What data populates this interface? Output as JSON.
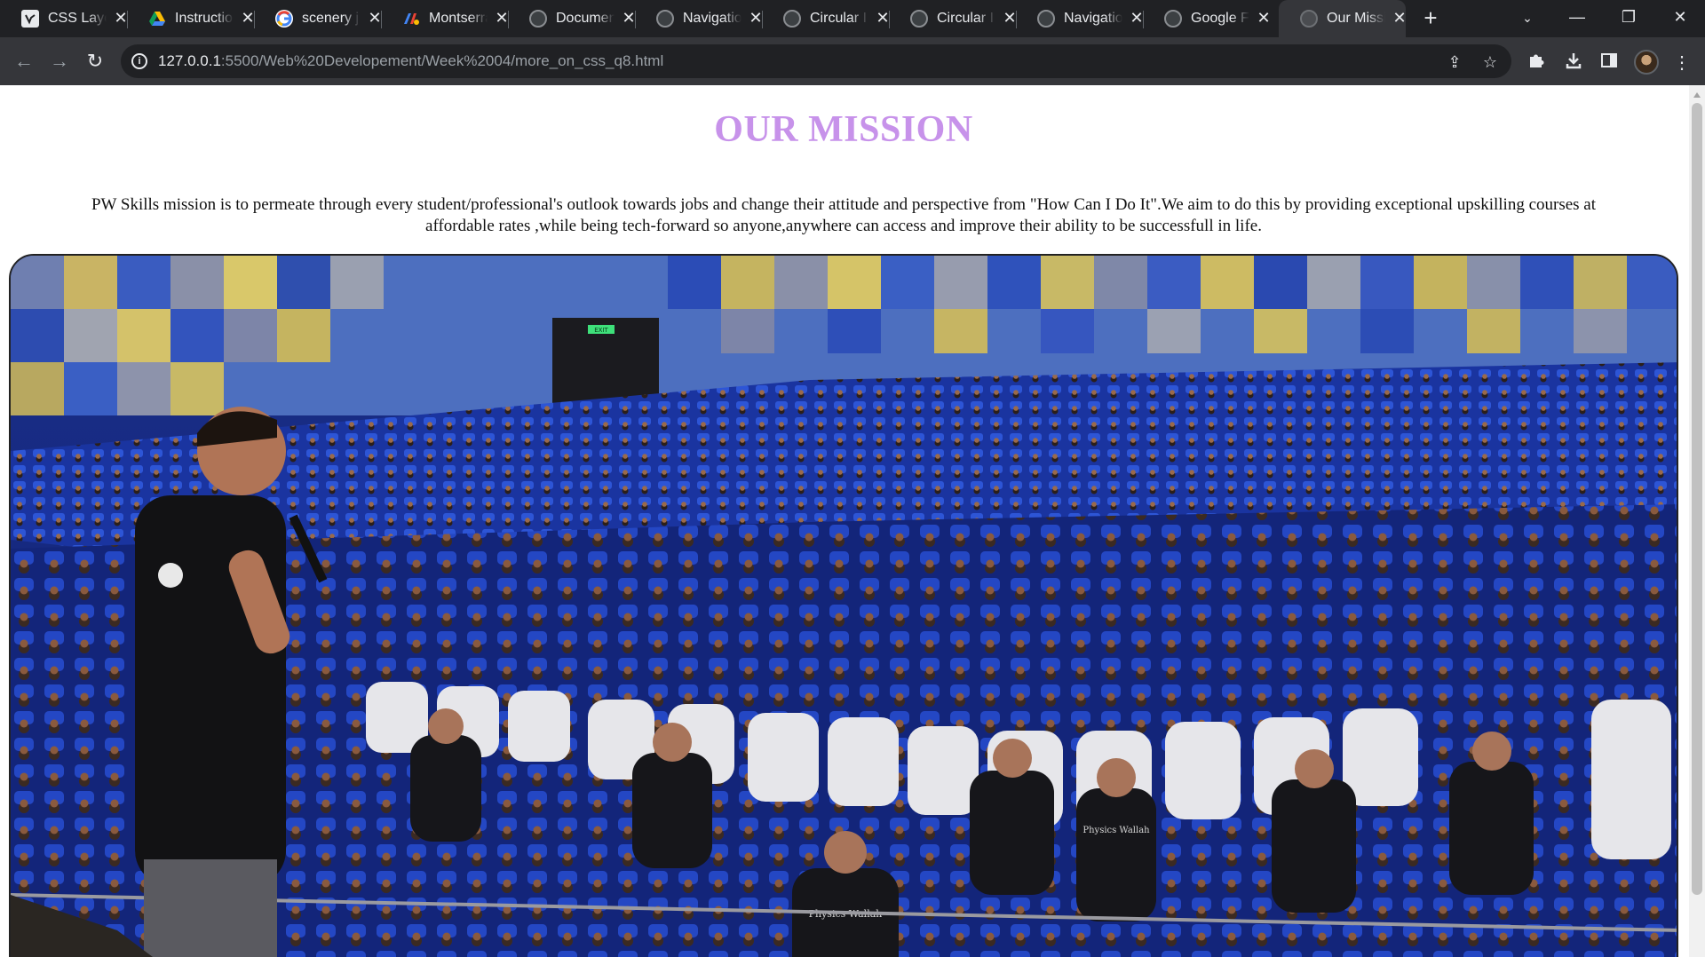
{
  "browser": {
    "tabs": [
      {
        "title": "CSS Layout",
        "icon": "css-tricks-icon",
        "color": "#ffffff"
      },
      {
        "title": "Instructions",
        "icon": "google-drive-icon",
        "color": "#34a853"
      },
      {
        "title": "scenery j",
        "icon": "google-icon",
        "color": "#4285f4"
      },
      {
        "title": "Montserrat",
        "icon": "google-fonts-icon",
        "color": "#1a73e8"
      },
      {
        "title": "Document",
        "icon": "globe-icon",
        "color": "#8a8d91"
      },
      {
        "title": "Navigation",
        "icon": "globe-icon",
        "color": "#8a8d91"
      },
      {
        "title": "Circular I",
        "icon": "globe-icon",
        "color": "#8a8d91"
      },
      {
        "title": "Circular I",
        "icon": "globe-icon",
        "color": "#8a8d91"
      },
      {
        "title": "Navigation",
        "icon": "globe-icon",
        "color": "#8a8d91"
      },
      {
        "title": "Google F",
        "icon": "globe-icon",
        "color": "#8a8d91"
      },
      {
        "title": "Our Mission",
        "icon": "globe-icon",
        "color": "#8a8d91",
        "active": true
      }
    ],
    "url_host": "127.0.0.1",
    "url_path": ":5500/Web%20Developement/Week%2004/more_on_css_q8.html"
  },
  "page": {
    "heading": "OUR MISSION",
    "heading_color": "#c792ea",
    "mission_text": "PW Skills mission is to permeate through every student/professional's outlook towards jobs and change their attitude and perspective from \"How Can I Do It\".We aim to do this by providing exceptional upskilling courses at affordable rates ,while being tech-forward so anyone,anywhere can access and improve their ability to be successfull in life.",
    "photo_text": {
      "exit_sign": "EXIT",
      "shirt_print_1": "Physics Wallah",
      "shirt_print_2": "Physics Wallah"
    }
  }
}
